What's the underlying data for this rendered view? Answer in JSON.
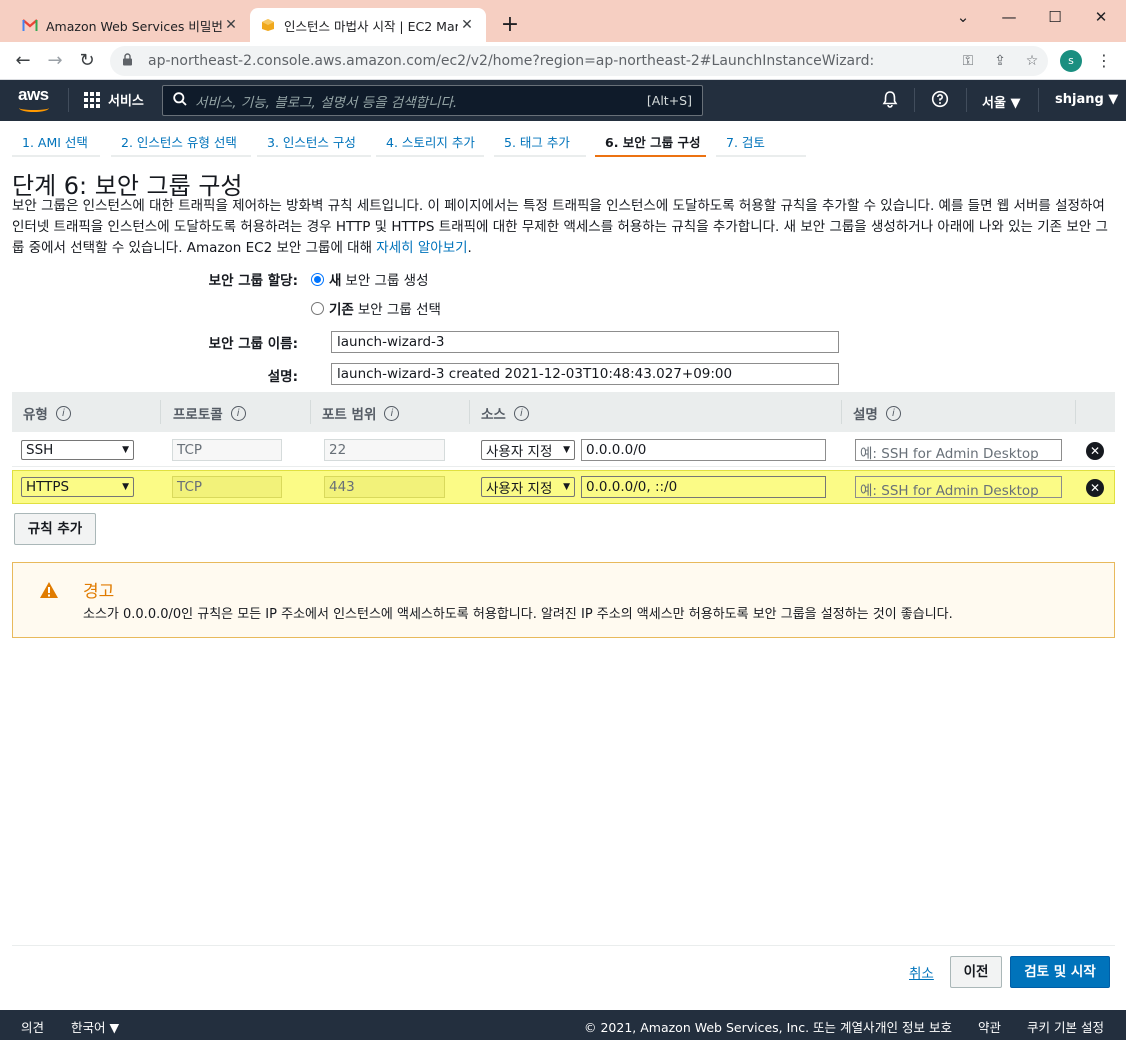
{
  "browser": {
    "tabs": [
      {
        "title": "Amazon Web Services 비밀번호"
      },
      {
        "title": "인스턴스 마법사 시작 | EC2 Mar"
      }
    ],
    "url": "ap-northeast-2.console.aws.amazon.com/ec2/v2/home?region=ap-northeast-2#LaunchInstanceWizard:",
    "profile_initial": "s"
  },
  "aws_header": {
    "logo": "aws",
    "services_label": "서비스",
    "search_placeholder": "서비스, 기능, 블로그, 설명서 등을 검색합니다.",
    "search_shortcut": "[Alt+S]",
    "region": "서울 ▼",
    "user": "shjang ▼"
  },
  "wizard": {
    "steps": [
      {
        "label": "1. AMI 선택"
      },
      {
        "label": "2. 인스턴스 유형 선택"
      },
      {
        "label": "3. 인스턴스 구성"
      },
      {
        "label": "4. 스토리지 추가"
      },
      {
        "label": "5. 태그 추가"
      },
      {
        "label": "6. 보안 그룹 구성"
      },
      {
        "label": "7. 검토"
      }
    ],
    "active_step": 5
  },
  "page": {
    "title": "단계 6: 보안 그룹 구성",
    "intro": "보안 그룹은 인스턴스에 대한 트래픽을 제어하는 방화벽 규칙 세트입니다. 이 페이지에서는 특정 트래픽을 인스턴스에 도달하도록 허용할 규칙을 추가할 수 있습니다. 예를 들면 웹 서버를 설정하여 인터넷 트래픽을 인스턴스에 도달하도록 허용하려는 경우 HTTP 및 HTTPS 트래픽에 대한 무제한 액세스를 허용하는 규칙을 추가합니다. 새 보안 그룹을 생성하거나 아래에 나와 있는 기존 보안 그룹 중에서 선택할 수 있습니다. Amazon EC2 보안 그룹에 대해 ",
    "intro_link": "자세히 알아보기",
    "intro_end": "."
  },
  "form": {
    "assign_label": "보안 그룹 할당:",
    "option_new_bold": "새",
    "option_new_rest": "보안 그룹 생성",
    "option_existing_bold": "기존",
    "option_existing_rest": "보안 그룹 선택",
    "name_label": "보안 그룹 이름:",
    "name_value": "launch-wizard-3",
    "desc_label": "설명:",
    "desc_value": "launch-wizard-3 created 2021-12-03T10:48:43.027+09:00"
  },
  "table": {
    "headers": {
      "type": "유형",
      "protocol": "프로토콜",
      "port": "포트 범위",
      "source": "소스",
      "description": "설명"
    },
    "info_glyph": "i",
    "rows": [
      {
        "type": "SSH",
        "protocol": "TCP",
        "port": "22",
        "source_type": "사용자 지정",
        "source_cidr": "0.0.0.0/0",
        "desc_placeholder": "예: SSH for Admin Desktop"
      },
      {
        "type": "HTTPS",
        "protocol": "TCP",
        "port": "443",
        "source_type": "사용자 지정",
        "source_cidr": "0.0.0.0/0, ::/0",
        "desc_placeholder": "예: SSH for Admin Desktop"
      }
    ],
    "add_rule": "규칙 추가"
  },
  "warning": {
    "title": "경고",
    "text": "소스가 0.0.0.0/0인 규칙은 모든 IP 주소에서 인스턴스에 액세스하도록 허용합니다. 알려진 IP 주소의 액세스만 허용하도록 보안 그룹을 설정하는 것이 좋습니다.",
    "color": "#e07b00"
  },
  "actions": {
    "cancel": "취소",
    "previous": "이전",
    "review_launch": "검토 및 시작"
  },
  "footer": {
    "feedback": "의견",
    "language": "한국어 ▼",
    "copyright": "© 2021, Amazon Web Services, Inc. 또는 계열사.",
    "privacy": "개인 정보 보호",
    "terms": "약관",
    "cookies": "쿠키 기본 설정"
  },
  "colors": {
    "aws_nav": "#232f3e",
    "link": "#0073bb",
    "accent": "#ec7211",
    "highlight_row": "#fbfb86",
    "primary_button": "#0073bb"
  }
}
